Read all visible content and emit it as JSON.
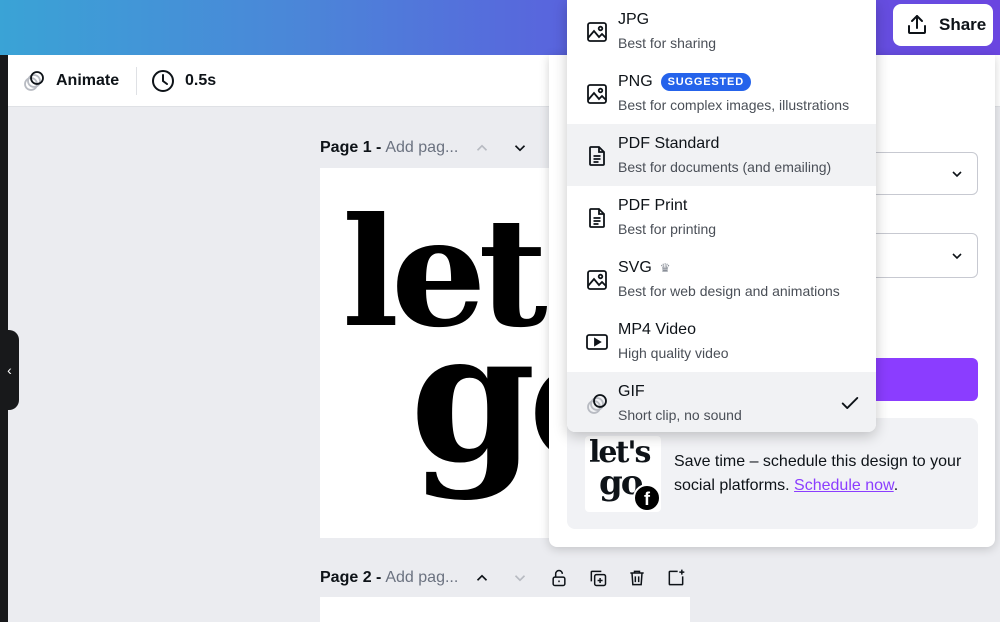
{
  "header": {
    "share_label": "Share"
  },
  "toolbar": {
    "animate_label": "Animate",
    "duration": "0.5s"
  },
  "pages": [
    {
      "label": "Page 1 -",
      "title_placeholder": "Add pag..."
    },
    {
      "label": "Page 2 -",
      "title_placeholder": "Add pag..."
    }
  ],
  "design_text": [
    "let's",
    "go"
  ],
  "file_types": [
    {
      "name": "JPG",
      "desc": "Best for sharing",
      "icon": "image-icon"
    },
    {
      "name": "PNG",
      "desc": "Best for complex images, illustrations",
      "icon": "image-icon",
      "badge": "SUGGESTED"
    },
    {
      "name": "PDF Standard",
      "desc": "Best for documents (and emailing)",
      "icon": "document-icon"
    },
    {
      "name": "PDF Print",
      "desc": "Best for printing",
      "icon": "document-icon"
    },
    {
      "name": "SVG",
      "desc": "Best for web design and animations",
      "icon": "image-icon",
      "premium": "crown-icon"
    },
    {
      "name": "MP4 Video",
      "desc": "High quality video",
      "icon": "video-icon"
    },
    {
      "name": "GIF",
      "desc": "Short clip, no sound",
      "icon": "gif-icon",
      "selected": true
    }
  ],
  "promo": {
    "text": "Save time – schedule this design to your social platforms.",
    "link": "Schedule now",
    "trailing": "."
  },
  "colors": {
    "accent": "#8b3dff",
    "badge": "#2563eb",
    "link": "#8b3dff"
  }
}
